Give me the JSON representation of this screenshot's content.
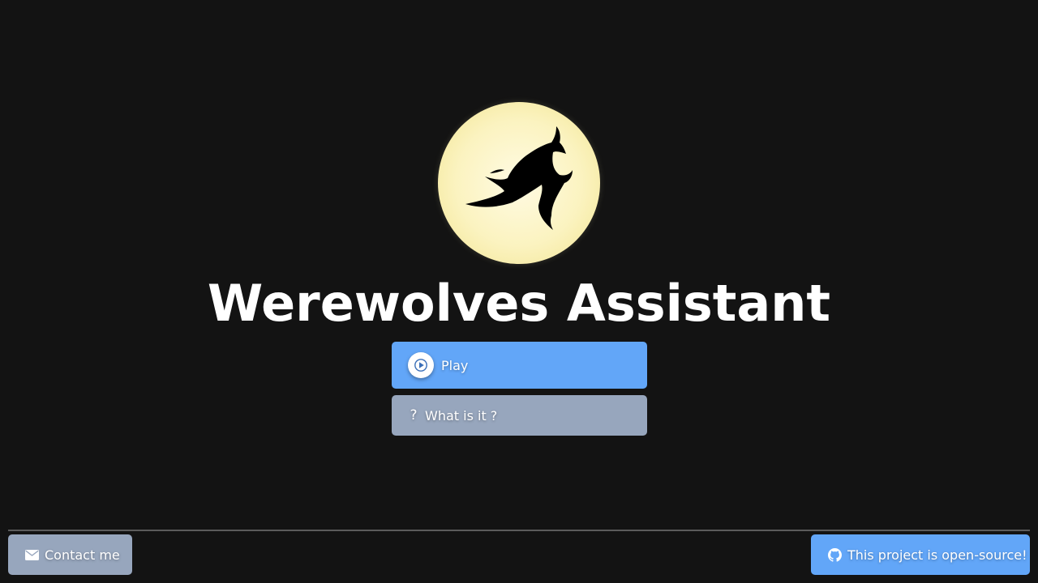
{
  "app": {
    "title": "Werewolves Assistant",
    "logo_icon": "howling-wolf-moon-logo"
  },
  "main": {
    "play_label": "Play",
    "play_icon": "play-circle-icon",
    "about_label": "What is it ?",
    "about_icon": "question-icon"
  },
  "footer": {
    "contact_label": "Contact me",
    "contact_icon": "envelope-icon",
    "github_label": "This project is open-source!",
    "github_icon": "github-icon"
  },
  "colors": {
    "background": "#131313",
    "primary": "#62a6f8",
    "secondary": "#97a6bd",
    "moon": "#fbf3c0",
    "divider": "#5b5b5b"
  }
}
